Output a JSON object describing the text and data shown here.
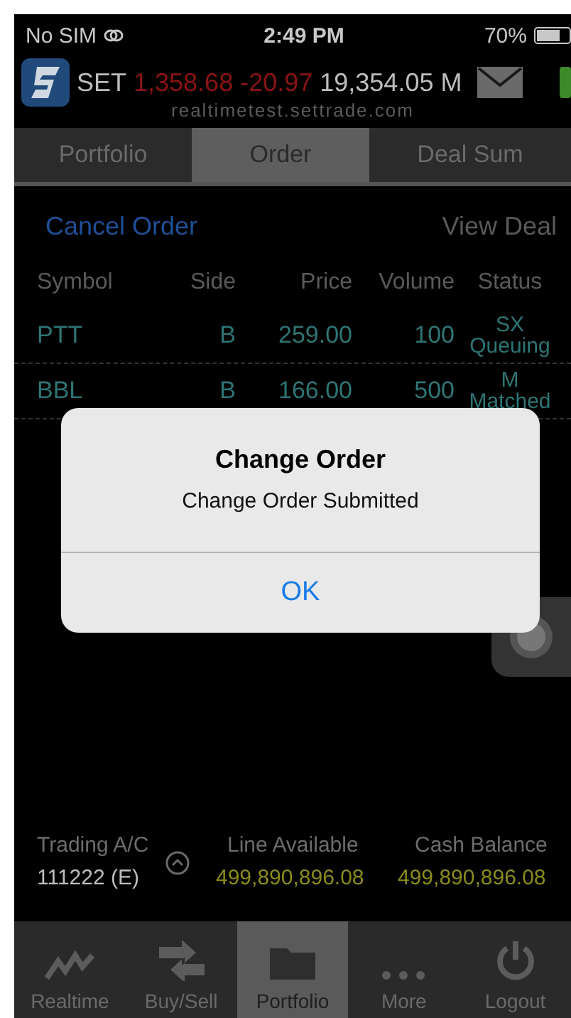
{
  "status_bar": {
    "carrier": "No SIM",
    "time": "2:49 PM",
    "battery": "70%"
  },
  "header": {
    "index_name": "SET",
    "index_value": "1,358.68",
    "change": "-20.97",
    "volume": "19,354.05 M",
    "server": "realtimetest.settrade.com"
  },
  "tabs": [
    {
      "label": "Portfolio",
      "selected": false
    },
    {
      "label": "Order",
      "selected": true
    },
    {
      "label": "Deal Sum",
      "selected": false
    }
  ],
  "actions": {
    "cancel": "Cancel Order",
    "view_deal": "View Deal"
  },
  "table": {
    "columns": [
      "Symbol",
      "Side",
      "Price",
      "Volume",
      "Status"
    ],
    "rows": [
      {
        "symbol": "PTT",
        "side": "B",
        "price": "259.00",
        "volume": "100",
        "status_code": "SX",
        "status": "Queuing"
      },
      {
        "symbol": "BBL",
        "side": "B",
        "price": "166.00",
        "volume": "500",
        "status_code": "M",
        "status": "Matched"
      }
    ]
  },
  "dialog": {
    "title": "Change Order",
    "message": "Change Order Submitted",
    "button": "OK"
  },
  "account": {
    "trading_label": "Trading A/C",
    "trading_value": "111222 (E)",
    "line_label": "Line Available",
    "line_value": "499,890,896.08",
    "cash_label": "Cash Balance",
    "cash_value": "499,890,896.08"
  },
  "bottom_tabs": [
    {
      "kind": "realtime",
      "label": "Realtime",
      "selected": false
    },
    {
      "kind": "trade",
      "label": "Buy/Sell",
      "selected": false
    },
    {
      "kind": "portfolio",
      "label": "Portfolio",
      "selected": true
    },
    {
      "kind": "more",
      "label": "More",
      "selected": false
    },
    {
      "kind": "logout",
      "label": "Logout",
      "selected": false
    }
  ]
}
